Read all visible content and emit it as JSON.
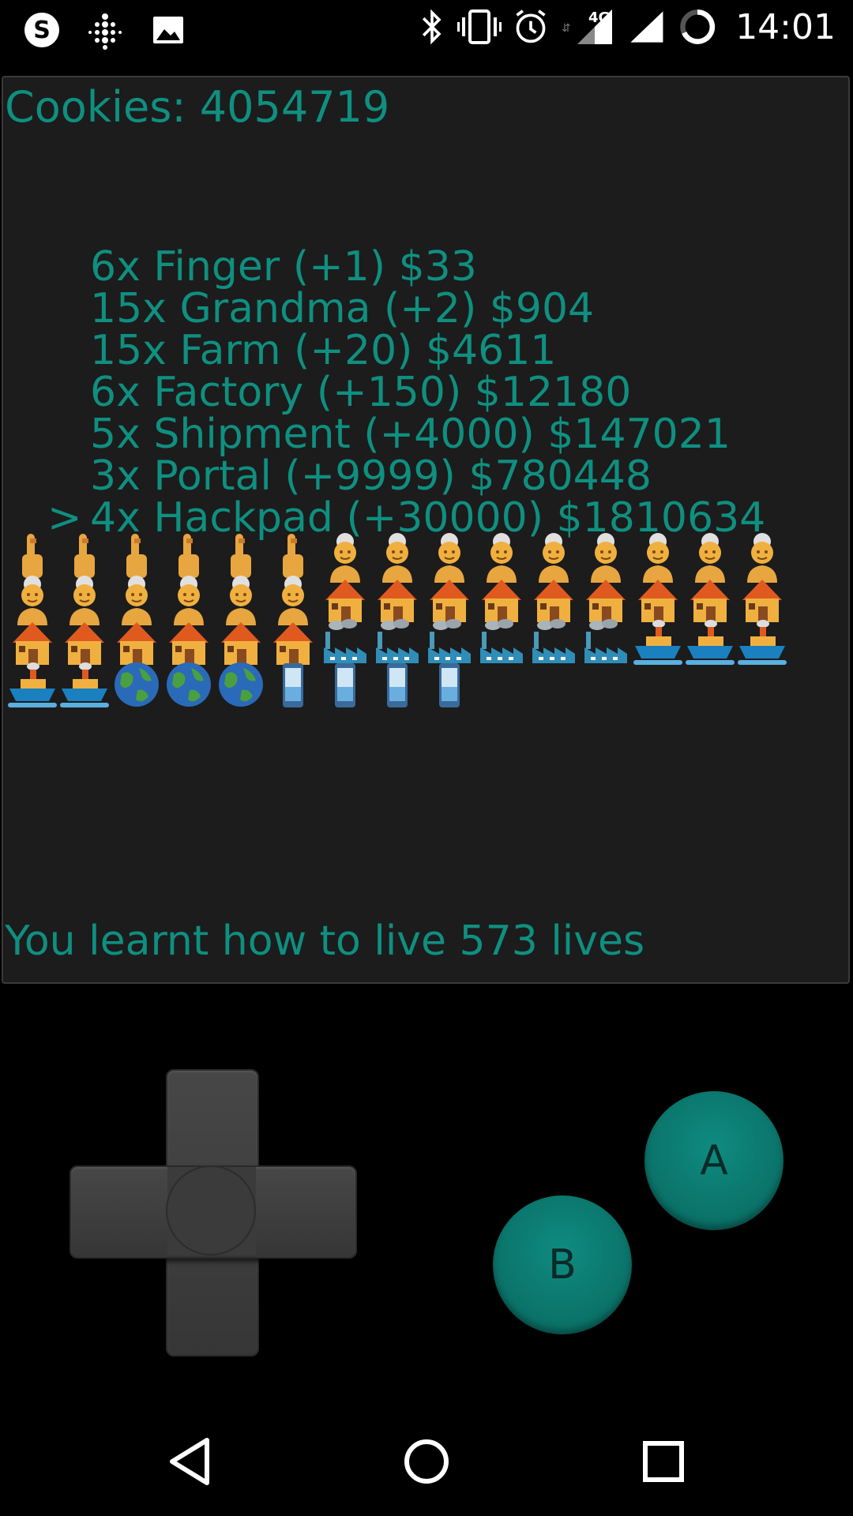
{
  "status_bar": {
    "time": "14:01",
    "network": "4G",
    "icons_left": [
      "skype-icon",
      "fitbit-icon",
      "gallery-icon"
    ],
    "icons_right": [
      "bluetooth-icon",
      "vibrate-icon",
      "alarm-icon",
      "signal-4g-icon",
      "signal-icon",
      "battery-ring-icon"
    ]
  },
  "game": {
    "cookies_label": "Cookies: 4054719",
    "shop_items": [
      {
        "cursor": "",
        "label": "6x Finger (+1) $33"
      },
      {
        "cursor": "",
        "label": "15x Grandma (+2) $904"
      },
      {
        "cursor": "",
        "label": "15x Farm (+20) $4611"
      },
      {
        "cursor": "",
        "label": "6x Factory (+150) $12180"
      },
      {
        "cursor": "",
        "label": "5x Shipment (+4000) $147021"
      },
      {
        "cursor": "",
        "label": "3x Portal (+9999) $780448"
      },
      {
        "cursor": ">",
        "label": "4x Hackpad (+30000) $1810634"
      }
    ],
    "emoji_rows": [
      [
        "finger",
        "finger",
        "finger",
        "finger",
        "finger",
        "finger",
        "grandma",
        "grandma",
        "grandma",
        "grandma",
        "grandma",
        "grandma",
        "grandma",
        "grandma",
        "grandma"
      ],
      [
        "grandma",
        "grandma",
        "grandma",
        "grandma",
        "grandma",
        "grandma",
        "farm",
        "farm",
        "farm",
        "farm",
        "farm",
        "farm",
        "farm",
        "farm",
        "farm"
      ],
      [
        "farm",
        "farm",
        "farm",
        "farm",
        "farm",
        "farm",
        "factory",
        "factory",
        "factory",
        "factory",
        "factory",
        "factory",
        "shipment",
        "shipment",
        "shipment"
      ],
      [
        "shipment",
        "shipment",
        "portal",
        "portal",
        "portal",
        "hackpad",
        "hackpad",
        "hackpad",
        "hackpad"
      ]
    ],
    "lives_label": "You learnt how to live 573 lives"
  },
  "controls": {
    "a_label": "A",
    "b_label": "B"
  },
  "colors": {
    "accent": "#0f8f80",
    "screen_bg": "#1c1c1c"
  }
}
